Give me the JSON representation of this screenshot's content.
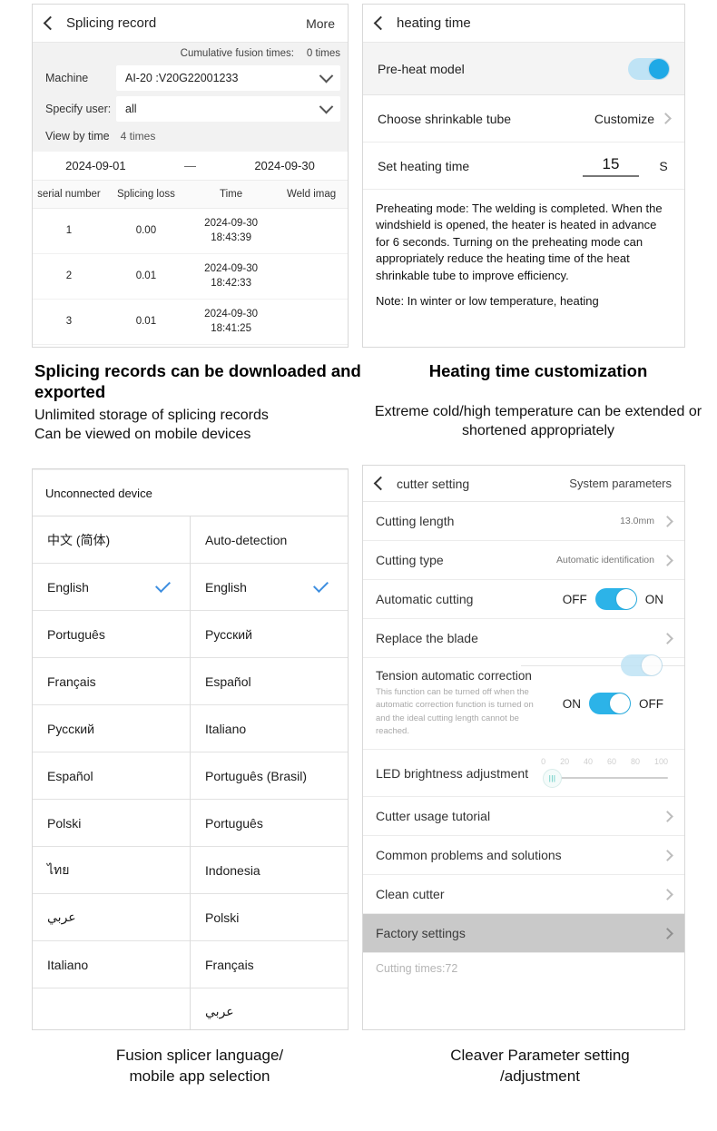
{
  "panel_splicing": {
    "nav": {
      "title": "Splicing record",
      "right": "More",
      "back_icon": "chevron-left-icon"
    },
    "cumulative_label": "Cumulative fusion times:",
    "cumulative_value": "0 times",
    "machine_label": "Machine",
    "machine_value": "AI-20 :V20G22001233",
    "user_label": "Specify user:",
    "user_value": "all",
    "view_by_time_label": "View by time",
    "view_by_time_value": "4 times",
    "date_start": "2024-09-01",
    "date_dash": "—",
    "date_end": "2024-09-30",
    "columns": [
      "serial number",
      "Splicing loss",
      "Time",
      "Weld imag"
    ],
    "rows": [
      {
        "serial": "1",
        "loss": "0.00",
        "date": "2024-09-30",
        "time": "18:43:39",
        "image": ""
      },
      {
        "serial": "2",
        "loss": "0.01",
        "date": "2024-09-30",
        "time": "18:42:33",
        "image": ""
      },
      {
        "serial": "3",
        "loss": "0.01",
        "date": "2024-09-30",
        "time": "18:41:25",
        "image": ""
      }
    ]
  },
  "panel_heating": {
    "nav": {
      "title": "heating time",
      "back_icon": "chevron-left-icon"
    },
    "preheat_label": "Pre-heat model",
    "preheat_state": "on",
    "tube_label": "Choose shrinkable tube",
    "tube_value": "Customize",
    "set_time_label": "Set heating time",
    "set_time_value": "15",
    "set_time_unit": "S",
    "note_p1": "Preheating mode: The welding is completed. When the windshield is opened, the heater is heated in advance for 6 seconds. Turning on the preheating mode can appropriately reduce the heating time of the heat shrinkable tube to improve efficiency.",
    "note_p2": "Note: In winter or low temperature, heating"
  },
  "panel_language": {
    "unconnected_label": "Unconnected device",
    "left_items": [
      {
        "label": "中文 (简体)",
        "selected": false
      },
      {
        "label": "English",
        "selected": true
      },
      {
        "label": "Português",
        "selected": false
      },
      {
        "label": "Français",
        "selected": false
      },
      {
        "label": "Русский",
        "selected": false
      },
      {
        "label": "Español",
        "selected": false
      },
      {
        "label": "Polski",
        "selected": false
      },
      {
        "label": "ไทย",
        "selected": false
      },
      {
        "label": "عربي",
        "selected": false,
        "rtl": true
      },
      {
        "label": "Italiano",
        "selected": false
      },
      {
        "label": "",
        "selected": false
      }
    ],
    "right_items": [
      {
        "label": "Auto-detection",
        "selected": false
      },
      {
        "label": "English",
        "selected": true
      },
      {
        "label": "Русский",
        "selected": false
      },
      {
        "label": "Español",
        "selected": false
      },
      {
        "label": "Italiano",
        "selected": false
      },
      {
        "label": "Português (Brasil)",
        "selected": false
      },
      {
        "label": "Português",
        "selected": false
      },
      {
        "label": "Indonesia",
        "selected": false
      },
      {
        "label": "Polski",
        "selected": false
      },
      {
        "label": "Français",
        "selected": false
      },
      {
        "label": "عربي",
        "selected": false,
        "rtl": true
      }
    ]
  },
  "panel_cutter": {
    "nav": {
      "title": "cutter setting",
      "right": "System parameters",
      "back_icon": "chevron-left-icon"
    },
    "cutting_length_label": "Cutting length",
    "cutting_length_value": "13.0mm",
    "cutting_type_label": "Cutting type",
    "cutting_type_value": "Automatic identification",
    "auto_cut_label": "Automatic cutting",
    "auto_cut_off": "OFF",
    "auto_cut_on": "ON",
    "auto_cut_state": "on",
    "replace_blade_label": "Replace the blade",
    "tension_title": "Tension automatic correction",
    "tension_desc": "This function can be turned off when the automatic correction function is turned on and the ideal cutting length cannot be reached.",
    "tension_on": "ON",
    "tension_off": "OFF",
    "tension_state": "on",
    "led_label": "LED brightness adjustment",
    "led_ticks": [
      "0",
      "20",
      "40",
      "60",
      "80",
      "100"
    ],
    "led_value": "0",
    "tutorial_label": "Cutter usage tutorial",
    "problems_label": "Common problems and solutions",
    "clean_label": "Clean cutter",
    "factory_label": "Factory settings",
    "cutting_times": "Cutting times:72"
  },
  "captions": {
    "c1_title": "Splicing records can be downloaded and exported",
    "c1_line1": "Unlimited storage of splicing records",
    "c1_line2": "Can be viewed on mobile devices",
    "c2_title": "Heating time customization",
    "c2_line1": "Extreme cold/high temperature can be extended or shortened appropriately",
    "c3_line1": "Fusion splicer language/",
    "c3_line2": "mobile app selection",
    "c4_line1": "Cleaver Parameter setting",
    "c4_line2": "/adjustment"
  },
  "colors": {
    "accent_blue": "#1fa9e6",
    "toggle_track": "#bfe3f5",
    "check_blue": "#3d8ee0",
    "highlight_grey": "#c9c9c9"
  }
}
